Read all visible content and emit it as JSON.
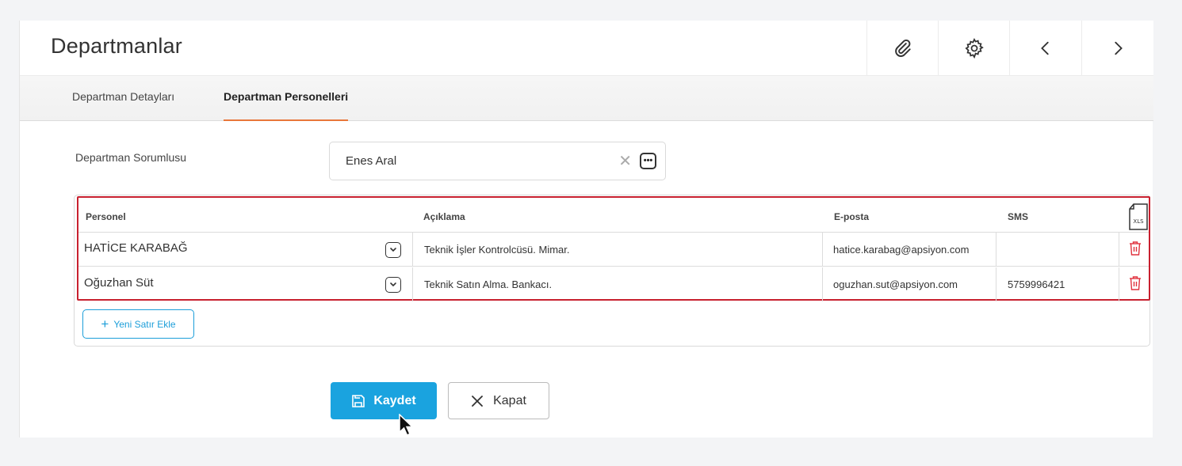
{
  "header": {
    "title": "Departmanlar",
    "buttons": [
      "paperclip-icon",
      "gear-icon",
      "chevron-left-icon",
      "chevron-right-icon"
    ]
  },
  "tabs": [
    {
      "label": "Departman Detayları",
      "active": false
    },
    {
      "label": "Departman Personelleri",
      "active": true
    }
  ],
  "form": {
    "manager_label": "Departman Sorumlusu",
    "manager_value": "Enes Aral"
  },
  "grid": {
    "columns": [
      "Personel",
      "Açıklama",
      "E-posta",
      "SMS"
    ],
    "rows": [
      {
        "person": "HATİCE KARABAĞ",
        "description": "Teknik İşler Kontrolcüsü. Mimar.",
        "email": "hatice.karabag@apsiyon.com",
        "sms": ""
      },
      {
        "person": "Oğuzhan Süt",
        "description": "Teknik Satın Alma. Bankacı.",
        "email": "oguzhan.sut@apsiyon.com",
        "sms": "5759996421"
      }
    ],
    "add_row_label": "Yeni Satır Ekle",
    "export_label": "XLS"
  },
  "actions": {
    "save_label": "Kaydet",
    "close_label": "Kapat"
  },
  "colors": {
    "accent": "#1aa3df",
    "tab_active": "#e8773a",
    "grid_border": "#c8202f",
    "delete": "#e0323e"
  }
}
